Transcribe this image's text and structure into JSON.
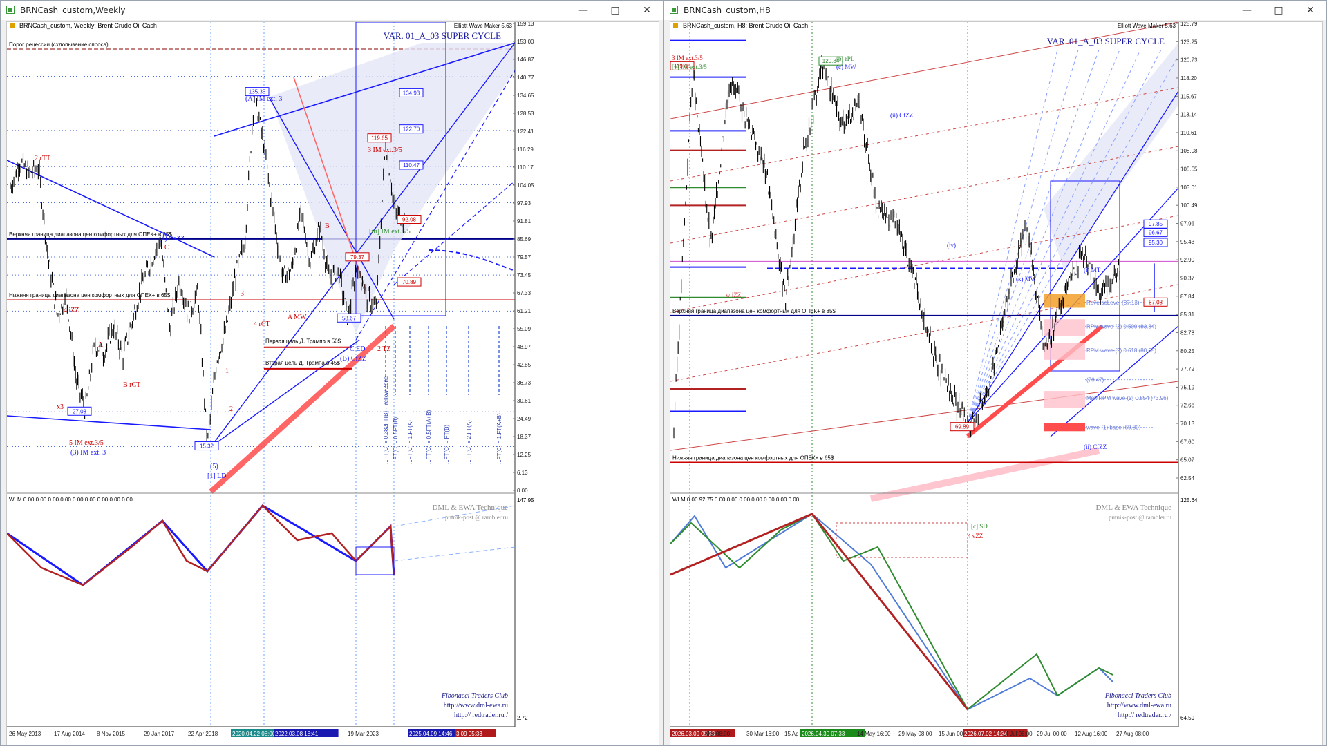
{
  "colors": {
    "bull": "#000000",
    "blueLine": "#1a1aff",
    "redLine": "#cc0000",
    "pinkLine": "#ff6666",
    "fibBlue": "#4f6fd8",
    "lightBlue": "#d8dcf7",
    "magenta": "#d04bd0",
    "green": "#2e8b2e",
    "orange": "#f2a12a",
    "pink": "#ffc0cb"
  },
  "left": {
    "window_title": "BRNCash_custom,Weekly",
    "header": "BRNCash_custom, Weekly:  Brent Crude Oil Cash",
    "indicator_label": "Elliott Wave Maker 5.63",
    "variant_label": "VAR. 01_A_03 SUPER CYCLE",
    "recession_label": "Порог рецессии (схлопывание спроса)",
    "recession_value": "150.00",
    "upper_opec_label": "Верхняя граница диапазона цен комфортных для ОПЕК+ в 85$",
    "lower_opec_label": "Нижняя граница диапазона цен комфортных для ОПЕК+ в 65$",
    "trump1": "Первая цель Д. Трампа в 50$",
    "trump2": "Вторая цель Д. Трампа в 45$",
    "last_price": "92.79",
    "price_boxes": [
      {
        "text": "135.35"
      },
      {
        "text": "134.93"
      },
      {
        "text": "122.70"
      },
      {
        "text": "119.65"
      },
      {
        "text": "110.47"
      },
      {
        "text": "92.08"
      },
      {
        "text": "79.37"
      },
      {
        "text": "70.89"
      },
      {
        "text": "58.67"
      },
      {
        "text": "27.08"
      },
      {
        "text": "15.32"
      }
    ],
    "y_ticks": [
      "159.13",
      "153.00",
      "146.87",
      "140.77",
      "134.65",
      "128.53",
      "122.41",
      "116.29",
      "110.17",
      "104.05",
      "97.93",
      "91.81",
      "85.69",
      "79.57",
      "73.45",
      "67.33",
      "61.21",
      "55.09",
      "48.97",
      "42.85",
      "36.73",
      "30.61",
      "24.49",
      "18.37",
      "12.25",
      "6.13",
      "0.00"
    ],
    "x_ticks": [
      "26 May 2013",
      "17 Aug 2014",
      "8 Nov 2015",
      "29 Jan 2017",
      "22 Apr 2018",
      "2020.04.22 08:00",
      "2022.03.08 18:41",
      "19 Mar 2023",
      "2025.04.09 14:46",
      "3.09 05:33"
    ],
    "wave_labels": [
      {
        "text": "2 rTT"
      },
      {
        "text": "x3"
      },
      {
        "text": "4 iZZ"
      },
      {
        "text": "A"
      },
      {
        "text": "B rCT"
      },
      {
        "text": "5 IM ext.3/5"
      },
      {
        "text": "(3) IM ext. 3"
      },
      {
        "text": "(4) CeZZ"
      },
      {
        "text": "C"
      },
      {
        "text": "(5)"
      },
      {
        "text": "[1] LD"
      },
      {
        "text": "(A) IM ext. 3"
      },
      {
        "text": "3 IM ext.3/5"
      },
      {
        "text": "[iii] IM ext.3/5"
      },
      {
        "text": "B"
      },
      {
        "text": "A MW"
      },
      {
        "text": "4 rCT"
      },
      {
        "text": "3"
      },
      {
        "text": "1"
      },
      {
        "text": "2"
      },
      {
        "text": "C ED"
      },
      {
        "text": "(B) CfZZ"
      },
      {
        "text": "2 TZ"
      }
    ],
    "fib_labels": [
      "...FT(C) = 0.382FT(B) - Yellow Zone",
      "...FT(C) = 0.5FT(B)",
      "...FT(C) = 1.FT(A)",
      "...FT(C) = 0.5FT(A+B)",
      "...FT(C) = FT(B)",
      "...FT(C) = 2.FT(A)",
      "...FT(C) = 1.FT(A+B)"
    ],
    "osc_label": "WLM 0.00 0.00 0.00 0.00 0.00 0.00 0.00 0.00 0.00",
    "osc_high": "147.95",
    "osc_low": "2.72",
    "brand1": "DML & EWA Technique",
    "brand2": "putnik-post @ rambler.ru",
    "brand3": "Fibonacci  Traders  Club",
    "brand4": "http://www.dml-ewa.ru",
    "brand5": "http://  redtrader.ru  /"
  },
  "right": {
    "window_title": "BRNCash_custom,H8",
    "header": "BRNCash_custom, H8:  Brent Crude Oil Cash",
    "indicator_label": "Elliott Wave Maker 5.63",
    "variant_label": "VAR. 01_A_03 SUPER CYCLE",
    "upper_opec_label": "Верхняя граница диапазона цен комфортных для ОПЕК+ в 85$",
    "lower_opec_label": "Нижняя граница диапазона цен комфортных для ОПЕК+ в 65$",
    "last_price": "92.79",
    "price_boxes": [
      {
        "text": "119.66"
      },
      {
        "text": "120.34"
      },
      {
        "text": "97.85"
      },
      {
        "text": "96.67"
      },
      {
        "text": "95.30"
      },
      {
        "text": "87.08"
      },
      {
        "text": "69.89"
      }
    ],
    "zone_labels": [
      {
        "text": "ReverseLevel (87.13)"
      },
      {
        "text": "RPM wave-(2) 0.500 (83.84)"
      },
      {
        "text": "RPM wave-(2) 0.618 (80.55)"
      },
      {
        "text": "(76.47)"
      },
      {
        "text": "Max RPM wave-(2) 0.854 (73.96)"
      },
      {
        "text": "wave-(1) base (69.89)"
      }
    ],
    "y_ticks": [
      "125.79",
      "123.25",
      "120.73",
      "118.20",
      "115.67",
      "113.14",
      "110.61",
      "108.08",
      "105.55",
      "103.01",
      "100.49",
      "97.96",
      "95.43",
      "92.90",
      "90.37",
      "87.84",
      "85.31",
      "82.78",
      "80.25",
      "77.72",
      "75.19",
      "72.66",
      "70.13",
      "67.60",
      "65.07",
      "62.54"
    ],
    "x_ticks": [
      "2026.03.09 05:33",
      "Mar 08:00",
      "30 Mar 16:00",
      "15 Ap",
      "2026.04.30 07:33",
      "14 May 16:00",
      "29 May 08:00",
      "15 Jun 00:00",
      "2026.07.02 14:34",
      "14 Jul 08:00",
      "29 Jul 00:00",
      "12 Aug 16:00",
      "27 Aug 08:00"
    ],
    "wave_labels": [
      {
        "text": "3 IM ext.3/5"
      },
      {
        "text": "[v] IM ext.3/5"
      },
      {
        "text": "(c) MW"
      },
      {
        "text": "[b] rPL"
      },
      {
        "text": "(ii) CfZZ"
      },
      {
        "text": "(iv)"
      },
      {
        "text": "w iZZ"
      },
      {
        "text": "(i) MT"
      },
      {
        "text": "(ii) CfZZ"
      },
      {
        "text": "4 vZZ"
      },
      {
        "text": "[c] SD"
      },
      {
        "text": "(x) MW"
      }
    ],
    "osc_label": "WLM 0.00 92.75 0.00 0.00 0.00 0.00 0.00 0.00 0.00",
    "osc_high": "125.64",
    "osc_low": "64.59",
    "brand1": "DML & EWA Technique",
    "brand2": "putnik-post @ rambler.ru",
    "brand3": "Fibonacci  Traders  Club",
    "brand4": "http://www.dml-ewa.ru",
    "brand5": "http://  redtrader.ru  /"
  },
  "chart_data": [
    {
      "type": "line",
      "title": "BRNCash_custom, Weekly:  Brent Crude Oil Cash",
      "ylim": [
        0,
        159.13
      ],
      "x": [
        "2013-05",
        "2013-09",
        "2014-01",
        "2014-06",
        "2014-11",
        "2015-02",
        "2015-06",
        "2015-12",
        "2016-01",
        "2016-06",
        "2016-10",
        "2017-01",
        "2017-06",
        "2017-10",
        "2018-01",
        "2018-05",
        "2018-10",
        "2018-12",
        "2019-05",
        "2019-09",
        "2020-01",
        "2020-04",
        "2020-08",
        "2021-01",
        "2021-06",
        "2021-10",
        "2022-03",
        "2022-06",
        "2022-10",
        "2023-03",
        "2023-06",
        "2023-09",
        "2023-12",
        "2024-04",
        "2024-09",
        "2025-01",
        "2025-04",
        "2025-06",
        "2025-09",
        "2026-01",
        "2026-03",
        "2026-04",
        "2026-06"
      ],
      "series": [
        {
          "values": [
            103,
            112,
            108,
            110,
            80,
            60,
            66,
            38,
            28,
            50,
            47,
            56,
            46,
            58,
            70,
            78,
            86,
            55,
            72,
            60,
            68,
            16,
            45,
            55,
            73,
            85,
            135,
            118,
            95,
            73,
            75,
            95,
            78,
            90,
            72,
            75,
            58,
            78,
            66,
            62,
            119,
            95,
            92
          ]
        }
      ]
    },
    {
      "type": "line",
      "title": "BRNCash_custom, H8:  Brent Crude Oil Cash",
      "ylim": [
        62.54,
        125.79
      ],
      "x": [
        "2026-03-09",
        "2026-03-12",
        "2026-03-16",
        "2026-03-22",
        "2026-03-30",
        "2026-04-08",
        "2026-04-15",
        "2026-04-24",
        "2026-04-30",
        "2026-05-07",
        "2026-05-14",
        "2026-05-20",
        "2026-05-29",
        "2026-06-05",
        "2026-06-15",
        "2026-06-24",
        "2026-07-02",
        "2026-07-08",
        "2026-07-14",
        "2026-07-21",
        "2026-07-29",
        "2026-08-05",
        "2026-08-12",
        "2026-08-20",
        "2026-08-27"
      ],
      "series": [
        {
          "values": [
            70,
            119,
            95,
            118,
            112,
            105,
            87,
            108,
            120,
            112,
            114,
            100,
            98,
            90,
            80,
            74,
            70,
            76,
            88,
            98,
            80,
            88,
            94,
            88,
            92
          ]
        }
      ]
    }
  ]
}
